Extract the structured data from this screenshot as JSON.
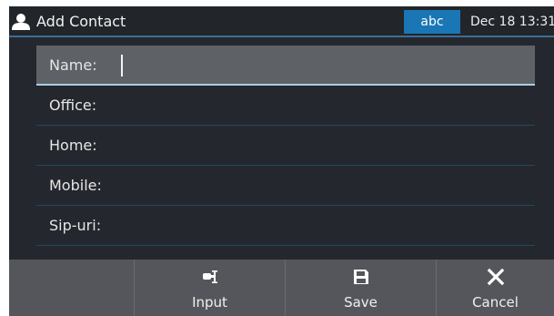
{
  "header": {
    "icon": "user-icon",
    "title": "Add Contact",
    "input_mode": "abc",
    "datetime": "Dec 18 13:31"
  },
  "fields": [
    {
      "label": "Name:",
      "value": "",
      "active": true
    },
    {
      "label": "Office:",
      "value": "",
      "active": false
    },
    {
      "label": "Home:",
      "value": "",
      "active": false
    },
    {
      "label": "Mobile:",
      "value": "",
      "active": false
    },
    {
      "label": "Sip-uri:",
      "value": "",
      "active": false
    }
  ],
  "softkeys": [
    {
      "label": "",
      "icon": ""
    },
    {
      "label": "Input",
      "icon": "input-method-icon"
    },
    {
      "label": "Save",
      "icon": "save-icon"
    },
    {
      "label": "Cancel",
      "icon": "close-icon"
    }
  ],
  "colors": {
    "screen_bg": "#25272e",
    "accent": "#1a76b5",
    "softkey_bar": "#54565b",
    "active_field": "#5e6266"
  }
}
